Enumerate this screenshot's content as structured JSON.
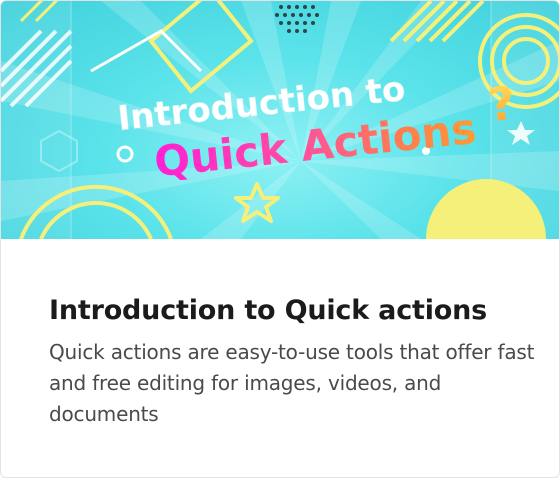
{
  "hero": {
    "line1": "Introduction to",
    "line2": "Quick Actions",
    "mark": "?"
  },
  "card": {
    "title": "Introduction to Quick actions",
    "description": "Quick actions are easy-to-use tools that offer fast and free editing for images, videos, and documents"
  },
  "colors": {
    "hero_bg": "#5be3ea",
    "accent_yellow": "#f4f07a",
    "title_text": "#1b1b1b",
    "body_text": "#4a4a4a"
  }
}
